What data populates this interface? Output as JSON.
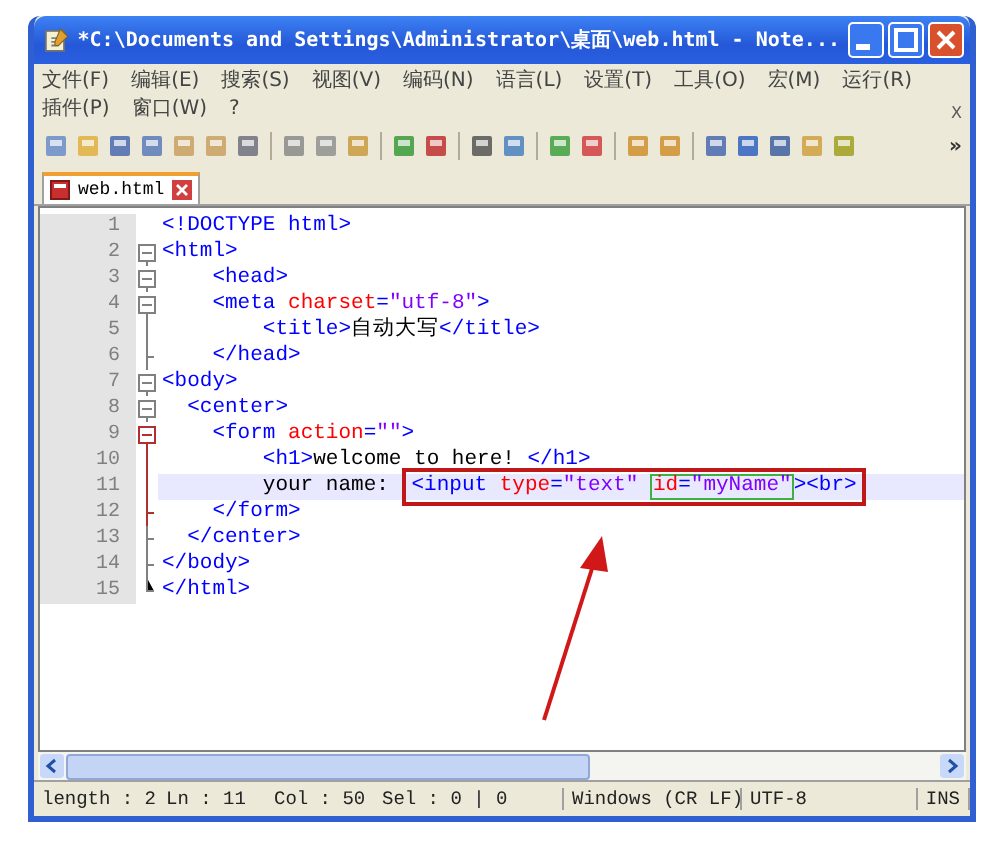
{
  "window": {
    "title": "*C:\\Documents and Settings\\Administrator\\桌面\\web.html - Note..."
  },
  "menu": {
    "items": [
      "文件(F)",
      "编辑(E)",
      "搜索(S)",
      "视图(V)",
      "编码(N)",
      "语言(L)",
      "设置(T)",
      "工具(O)",
      "宏(M)",
      "运行(R)",
      "插件(P)",
      "窗口(W)",
      "?"
    ],
    "close_mark": "X"
  },
  "toolbar": {
    "overflow": "»"
  },
  "tabs": [
    {
      "label": "web.html",
      "selected": true
    }
  ],
  "editor": {
    "lines": [
      {
        "number": "1",
        "kind": "plain",
        "current": false,
        "groups": [
          {
            "kind": "plain",
            "tokens": [
              {
                "kind": "tag",
                "text": "<!DOCTYPE html>"
              }
            ]
          }
        ]
      },
      {
        "number": "2",
        "kind": "fold_open",
        "current": false,
        "groups": [
          {
            "kind": "plain",
            "tokens": [
              {
                "kind": "tag",
                "text": "<html>"
              }
            ]
          }
        ]
      },
      {
        "number": "3",
        "kind": "fold_open",
        "current": false,
        "groups": [
          {
            "kind": "plain",
            "tokens": [
              {
                "kind": "tag",
                "text": "    <head>"
              }
            ]
          }
        ]
      },
      {
        "number": "4",
        "kind": "fold_open",
        "current": false,
        "groups": [
          {
            "kind": "plain",
            "tokens": [
              {
                "kind": "tag",
                "text": "    <meta "
              },
              {
                "kind": "attr",
                "text": "charset"
              },
              {
                "kind": "tag",
                "text": "="
              },
              {
                "kind": "string",
                "text": "\"utf-8\""
              },
              {
                "kind": "tag",
                "text": ">"
              }
            ]
          }
        ]
      },
      {
        "number": "5",
        "kind": "fold_line",
        "current": false,
        "groups": [
          {
            "kind": "plain",
            "tokens": [
              {
                "kind": "tag",
                "text": "        <title>"
              },
              {
                "kind": "text",
                "text": "自动大写"
              },
              {
                "kind": "tag",
                "text": "</title>"
              }
            ]
          }
        ]
      },
      {
        "number": "6",
        "kind": "fold_end",
        "current": false,
        "groups": [
          {
            "kind": "plain",
            "tokens": [
              {
                "kind": "tag",
                "text": "    </head>"
              }
            ]
          }
        ]
      },
      {
        "number": "7",
        "kind": "fold_open",
        "current": false,
        "groups": [
          {
            "kind": "plain",
            "tokens": [
              {
                "kind": "tag",
                "text": "<body>"
              }
            ]
          }
        ]
      },
      {
        "number": "8",
        "kind": "fold_open",
        "current": false,
        "groups": [
          {
            "kind": "plain",
            "tokens": [
              {
                "kind": "tag",
                "text": "  <center>"
              }
            ]
          }
        ]
      },
      {
        "number": "9",
        "kind": "fold_open_current",
        "current": false,
        "groups": [
          {
            "kind": "plain",
            "tokens": [
              {
                "kind": "tag",
                "text": "    <form "
              },
              {
                "kind": "attr",
                "text": "action"
              },
              {
                "kind": "tag",
                "text": "="
              },
              {
                "kind": "string",
                "text": "\"\""
              },
              {
                "kind": "tag",
                "text": ">"
              }
            ]
          }
        ]
      },
      {
        "number": "10",
        "kind": "fold_line_current",
        "current": false,
        "groups": [
          {
            "kind": "plain",
            "tokens": [
              {
                "kind": "tag",
                "text": "        <h1>"
              },
              {
                "kind": "text",
                "text": "welcome to here! "
              },
              {
                "kind": "tag",
                "text": "</h1>"
              }
            ]
          }
        ]
      },
      {
        "number": "11",
        "kind": "fold_line_current",
        "current": true,
        "groups": [
          {
            "kind": "plain",
            "tokens": [
              {
                "kind": "text",
                "text": "        your name: "
              }
            ]
          },
          {
            "kind": "annotation",
            "children": [
              {
                "kind": "plain",
                "tokens": [
                  {
                    "kind": "tag",
                    "text": "<input "
                  },
                  {
                    "kind": "attr",
                    "text": "type"
                  },
                  {
                    "kind": "tag",
                    "text": "="
                  },
                  {
                    "kind": "string",
                    "text": "\"text\" "
                  }
                ]
              },
              {
                "kind": "match",
                "tokens": [
                  {
                    "kind": "attr",
                    "text": "id"
                  },
                  {
                    "kind": "tag",
                    "text": "="
                  },
                  {
                    "kind": "string",
                    "text": "\"myName\""
                  }
                ]
              },
              {
                "kind": "plain",
                "tokens": [
                  {
                    "kind": "tag",
                    "text": "><br>"
                  }
                ]
              }
            ]
          }
        ]
      },
      {
        "number": "12",
        "kind": "fold_end_current",
        "current": false,
        "groups": [
          {
            "kind": "plain",
            "tokens": [
              {
                "kind": "tag",
                "text": "    </form>"
              }
            ]
          }
        ]
      },
      {
        "number": "13",
        "kind": "fold_end",
        "current": false,
        "groups": [
          {
            "kind": "plain",
            "tokens": [
              {
                "kind": "tag",
                "text": "  </center>"
              }
            ]
          }
        ]
      },
      {
        "number": "14",
        "kind": "fold_end",
        "current": false,
        "groups": [
          {
            "kind": "plain",
            "tokens": [
              {
                "kind": "tag",
                "text": "</body>"
              }
            ]
          }
        ]
      },
      {
        "number": "15",
        "kind": "fold_last",
        "current": false,
        "groups": [
          {
            "kind": "plain",
            "tokens": [
              {
                "kind": "tag",
                "text": "</html>"
              }
            ]
          }
        ]
      }
    ]
  },
  "status_bar": {
    "fields": [
      "length : 2",
      "Ln : 11",
      "Col : 50",
      "Sel : 0 | 0",
      "Windows (CR LF)",
      "UTF-8",
      "INS"
    ]
  }
}
